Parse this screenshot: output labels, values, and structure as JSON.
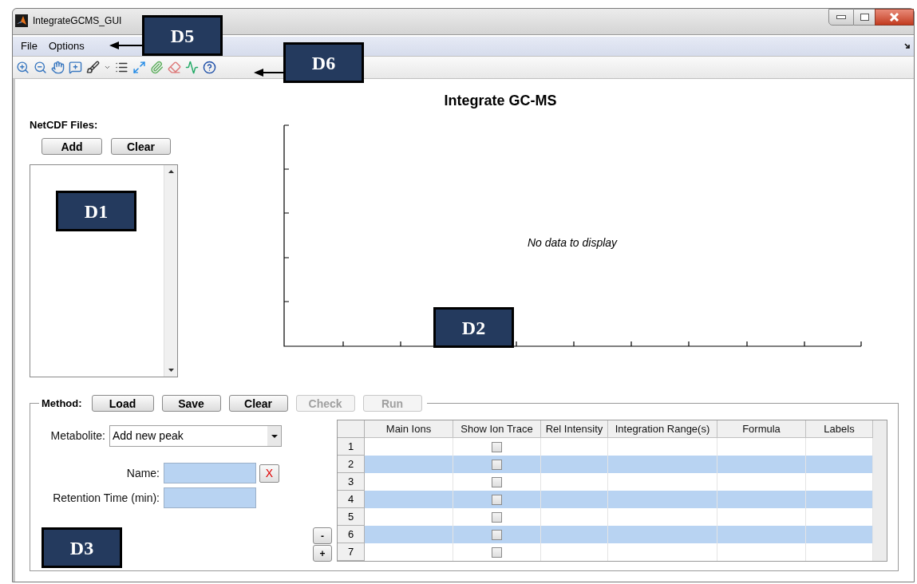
{
  "window": {
    "title": "IntegrateGCMS_GUI"
  },
  "menu": [
    {
      "label": "File"
    },
    {
      "label": "Options"
    }
  ],
  "title": "Integrate GC-MS",
  "files": {
    "label": "NetCDF Files:",
    "buttons": [
      {
        "label": "Add",
        "disabled": false
      },
      {
        "label": "Clear",
        "disabled": false
      }
    ]
  },
  "plot": {
    "message": "No data to display"
  },
  "method": {
    "label": "Method:",
    "buttons": [
      {
        "label": "Load",
        "disabled": false
      },
      {
        "label": "Save",
        "disabled": false
      },
      {
        "label": "Clear",
        "disabled": false
      },
      {
        "label": "Check",
        "disabled": true
      },
      {
        "label": "Run",
        "disabled": true
      }
    ],
    "metabolite": {
      "label": "Metabolite:",
      "value": "Add new peak"
    },
    "name": {
      "label": "Name:"
    },
    "clear_button": "X",
    "retention_time": {
      "label": "Retention Time (min):"
    },
    "row_buttons": [
      "-",
      "+"
    ],
    "table": {
      "columns": [
        "Main Ions",
        "Show Ion Trace",
        "Rel Intensity",
        "Integration Range(s)",
        "Formula",
        "Labels"
      ],
      "rows": [
        {
          "header": "1",
          "show_ion_trace": false
        },
        {
          "header": "2",
          "show_ion_trace": false
        },
        {
          "header": "3",
          "show_ion_trace": false
        },
        {
          "header": "4",
          "show_ion_trace": false
        },
        {
          "header": "5",
          "show_ion_trace": false
        },
        {
          "header": "6",
          "show_ion_trace": false
        },
        {
          "header": "7",
          "show_ion_trace": false
        }
      ]
    }
  },
  "annotations": [
    {
      "label": "D5",
      "arrow": true
    },
    {
      "label": "D6",
      "arrow": true
    },
    {
      "label": "D1",
      "arrow": false
    },
    {
      "label": "D2",
      "arrow": false
    },
    {
      "label": "D3",
      "arrow": false
    }
  ]
}
